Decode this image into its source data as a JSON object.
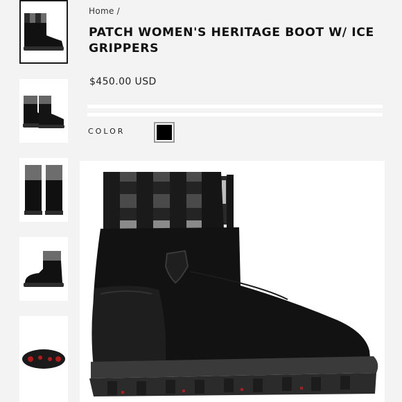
{
  "breadcrumb": {
    "home": "Home",
    "separator": "/"
  },
  "product": {
    "title": "PATCH WOMEN'S HERITAGE BOOT W/ ICE GRIPPERS",
    "price": "$450.00 USD"
  },
  "color_option": {
    "label": "COLOR",
    "swatches": [
      {
        "name": "black",
        "hex": "#000000",
        "selected": true
      }
    ]
  },
  "gallery": {
    "thumbnails": [
      {
        "view": "side",
        "selected": true
      },
      {
        "view": "pair-side",
        "selected": false
      },
      {
        "view": "back-pair",
        "selected": false
      },
      {
        "view": "side",
        "selected": false
      },
      {
        "view": "sole",
        "selected": false
      }
    ],
    "main_view": "side"
  },
  "colors": {
    "boot": "#121212",
    "plaid_dark": "#1b1b1b",
    "plaid_light": "#8d8d8d",
    "sole_accent": "#b11a1a"
  }
}
